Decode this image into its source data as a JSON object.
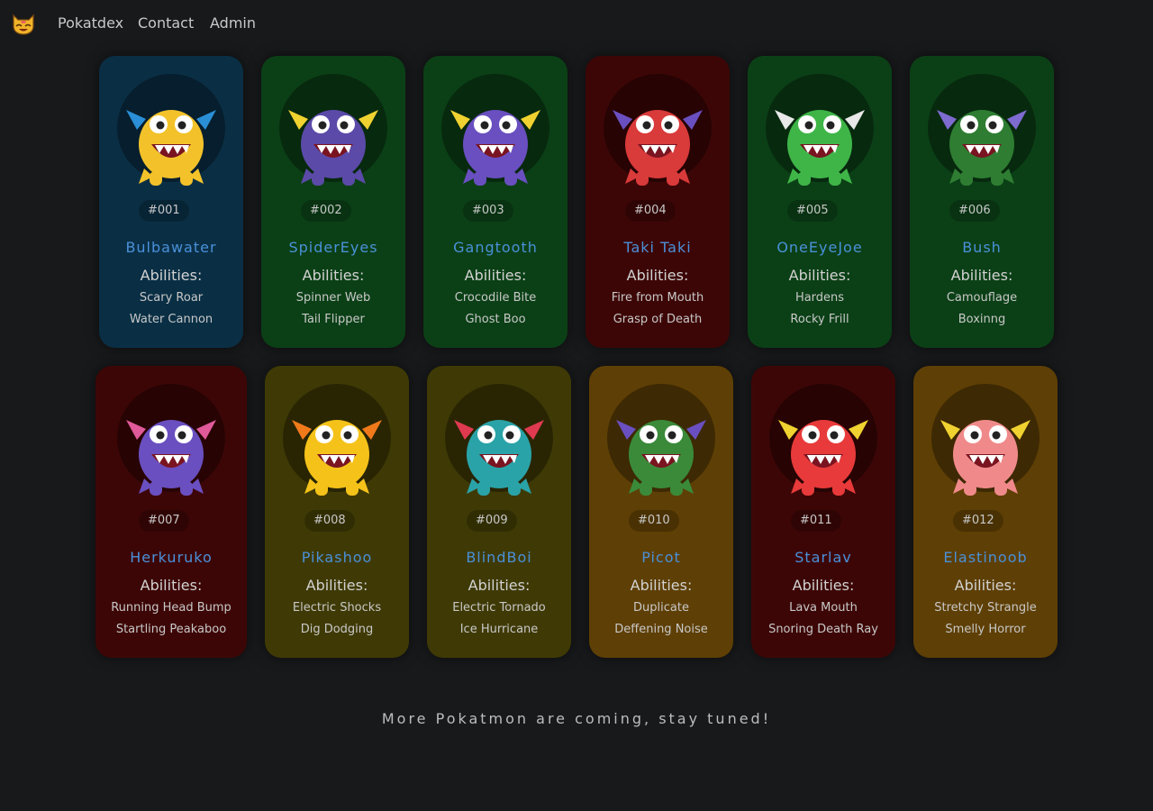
{
  "nav": {
    "logo_icon": "cat-face-icon",
    "links": [
      "Pokatdex",
      "Contact",
      "Admin"
    ]
  },
  "abilities_label": "Abilities:",
  "cards": [
    {
      "num": "#001",
      "name": "Bulbawater",
      "a1": "Scary Roar",
      "a2": "Water Cannon",
      "bg": "#0a2f45",
      "monster_color": "#f3c22b",
      "accent": "#2a8fd6"
    },
    {
      "num": "#002",
      "name": "SpiderEyes",
      "a1": "Spinner Web",
      "a2": "Tail Flipper",
      "bg": "#0b4016",
      "monster_color": "#5b4aa8",
      "accent": "#f0d230"
    },
    {
      "num": "#003",
      "name": "Gangtooth",
      "a1": "Crocodile Bite",
      "a2": "Ghost Boo",
      "bg": "#0b4016",
      "monster_color": "#6a4fc0",
      "accent": "#f0d230"
    },
    {
      "num": "#004",
      "name": "Taki Taki",
      "a1": "Fire from Mouth",
      "a2": "Grasp of Death",
      "bg": "#3d0606",
      "monster_color": "#d93a3a",
      "accent": "#6a4fc0"
    },
    {
      "num": "#005",
      "name": "OneEyeJoe",
      "a1": "Hardens",
      "a2": "Rocky Frill",
      "bg": "#0b4016",
      "monster_color": "#3fb548",
      "accent": "#e8e8e8"
    },
    {
      "num": "#006",
      "name": "Bush",
      "a1": "Camouflage",
      "a2": "Boxinng",
      "bg": "#0b4016",
      "monster_color": "#2e7d32",
      "accent": "#7e6bd0"
    },
    {
      "num": "#007",
      "name": "Herkuruko",
      "a1": "Running Head Bump",
      "a2": "Startling Peakaboo",
      "bg": "#3d0606",
      "monster_color": "#6a4fc0",
      "accent": "#e05a9a"
    },
    {
      "num": "#008",
      "name": "Pikashoo",
      "a1": "Electric Shocks",
      "a2": "Dig Dodging",
      "bg": "#3f3a05",
      "monster_color": "#f5c21a",
      "accent": "#f07a1a"
    },
    {
      "num": "#009",
      "name": "BlindBoi",
      "a1": "Electric Tornado",
      "a2": "Ice Hurricane",
      "bg": "#3f3a05",
      "monster_color": "#2aa3a8",
      "accent": "#e03a50"
    },
    {
      "num": "#010",
      "name": "Picot",
      "a1": "Duplicate",
      "a2": "Deffening Noise",
      "bg": "#5e3f05",
      "monster_color": "#3a8a3a",
      "accent": "#6a4fc0"
    },
    {
      "num": "#011",
      "name": "Starlav",
      "a1": "Lava Mouth",
      "a2": "Snoring Death Ray",
      "bg": "#3d0606",
      "monster_color": "#e83a3a",
      "accent": "#f0d230"
    },
    {
      "num": "#012",
      "name": "Elastinoob",
      "a1": "Stretchy Strangle",
      "a2": "Smelly Horror",
      "bg": "#5e3f05",
      "monster_color": "#f08a8a",
      "accent": "#f0d230"
    }
  ],
  "footer": "More Pokatmon are coming, stay tuned!"
}
